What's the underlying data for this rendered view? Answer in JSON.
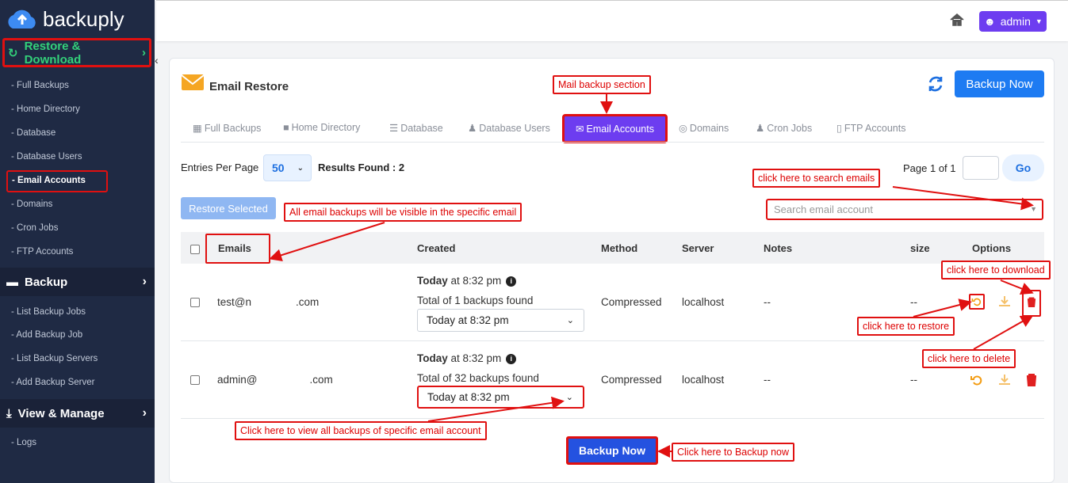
{
  "brand": "backuply",
  "sidebar": {
    "active_section": "Restore & Download",
    "restore_items": [
      "Full Backups",
      "Home Directory",
      "Database",
      "Database Users",
      "Email Accounts",
      "Domains",
      "Cron Jobs",
      "FTP Accounts"
    ],
    "backup_section": "Backup",
    "backup_items": [
      "List Backup Jobs",
      "Add Backup Job",
      "List Backup Servers",
      "Add Backup Server"
    ],
    "view_section": "View & Manage",
    "view_items": [
      "Logs"
    ]
  },
  "topbar": {
    "user": "admin"
  },
  "page": {
    "title": "Email Restore",
    "backup_now": "Backup Now",
    "tabs": [
      "Full Backups",
      "Home Directory",
      "Database",
      "Database Users",
      "Email Accounts",
      "Domains",
      "Cron Jobs",
      "FTP Accounts"
    ],
    "entries_label": "Entries Per Page",
    "entries_value": "50",
    "results": "Results Found : 2",
    "page_info": "Page 1 of 1",
    "go": "Go",
    "restore_selected": "Restore Selected",
    "search_placeholder": "Search email account"
  },
  "table": {
    "headers": [
      "Emails",
      "Created",
      "Method",
      "Server",
      "Notes",
      "size",
      "Options"
    ],
    "rows": [
      {
        "email_start": "test@n",
        "email_end": ".com",
        "today": "Today",
        "time": " at 8:32 pm",
        "total": "Total of 1 backups found",
        "dropdown": "Today at 8:32 pm",
        "method": "Compressed",
        "server": "localhost",
        "notes": "--",
        "size": "--"
      },
      {
        "email_start": "admin@",
        "email_end": ".com",
        "today": "Today",
        "time": " at 8:32 pm",
        "total": "Total of 32 backups found",
        "dropdown": "Today at 8:32 pm",
        "method": "Compressed",
        "server": "localhost",
        "notes": "--",
        "size": "--"
      }
    ]
  },
  "callouts": {
    "mail_section": "Mail backup section",
    "search": "click here to search emails",
    "visible": "All email backups will be visible in the specific email",
    "download": "click here to download",
    "restore": "click here to restore",
    "delete": "click here to delete",
    "view_all": "Click here to view all backups of specific email account",
    "backup_now": "Click here to Backup now"
  },
  "colors": {
    "sidebar": "#1f2a44",
    "accent": "#6d3df0",
    "primary": "#1d7bf2",
    "annotation": "#e01010",
    "active_green": "#33d17a"
  }
}
